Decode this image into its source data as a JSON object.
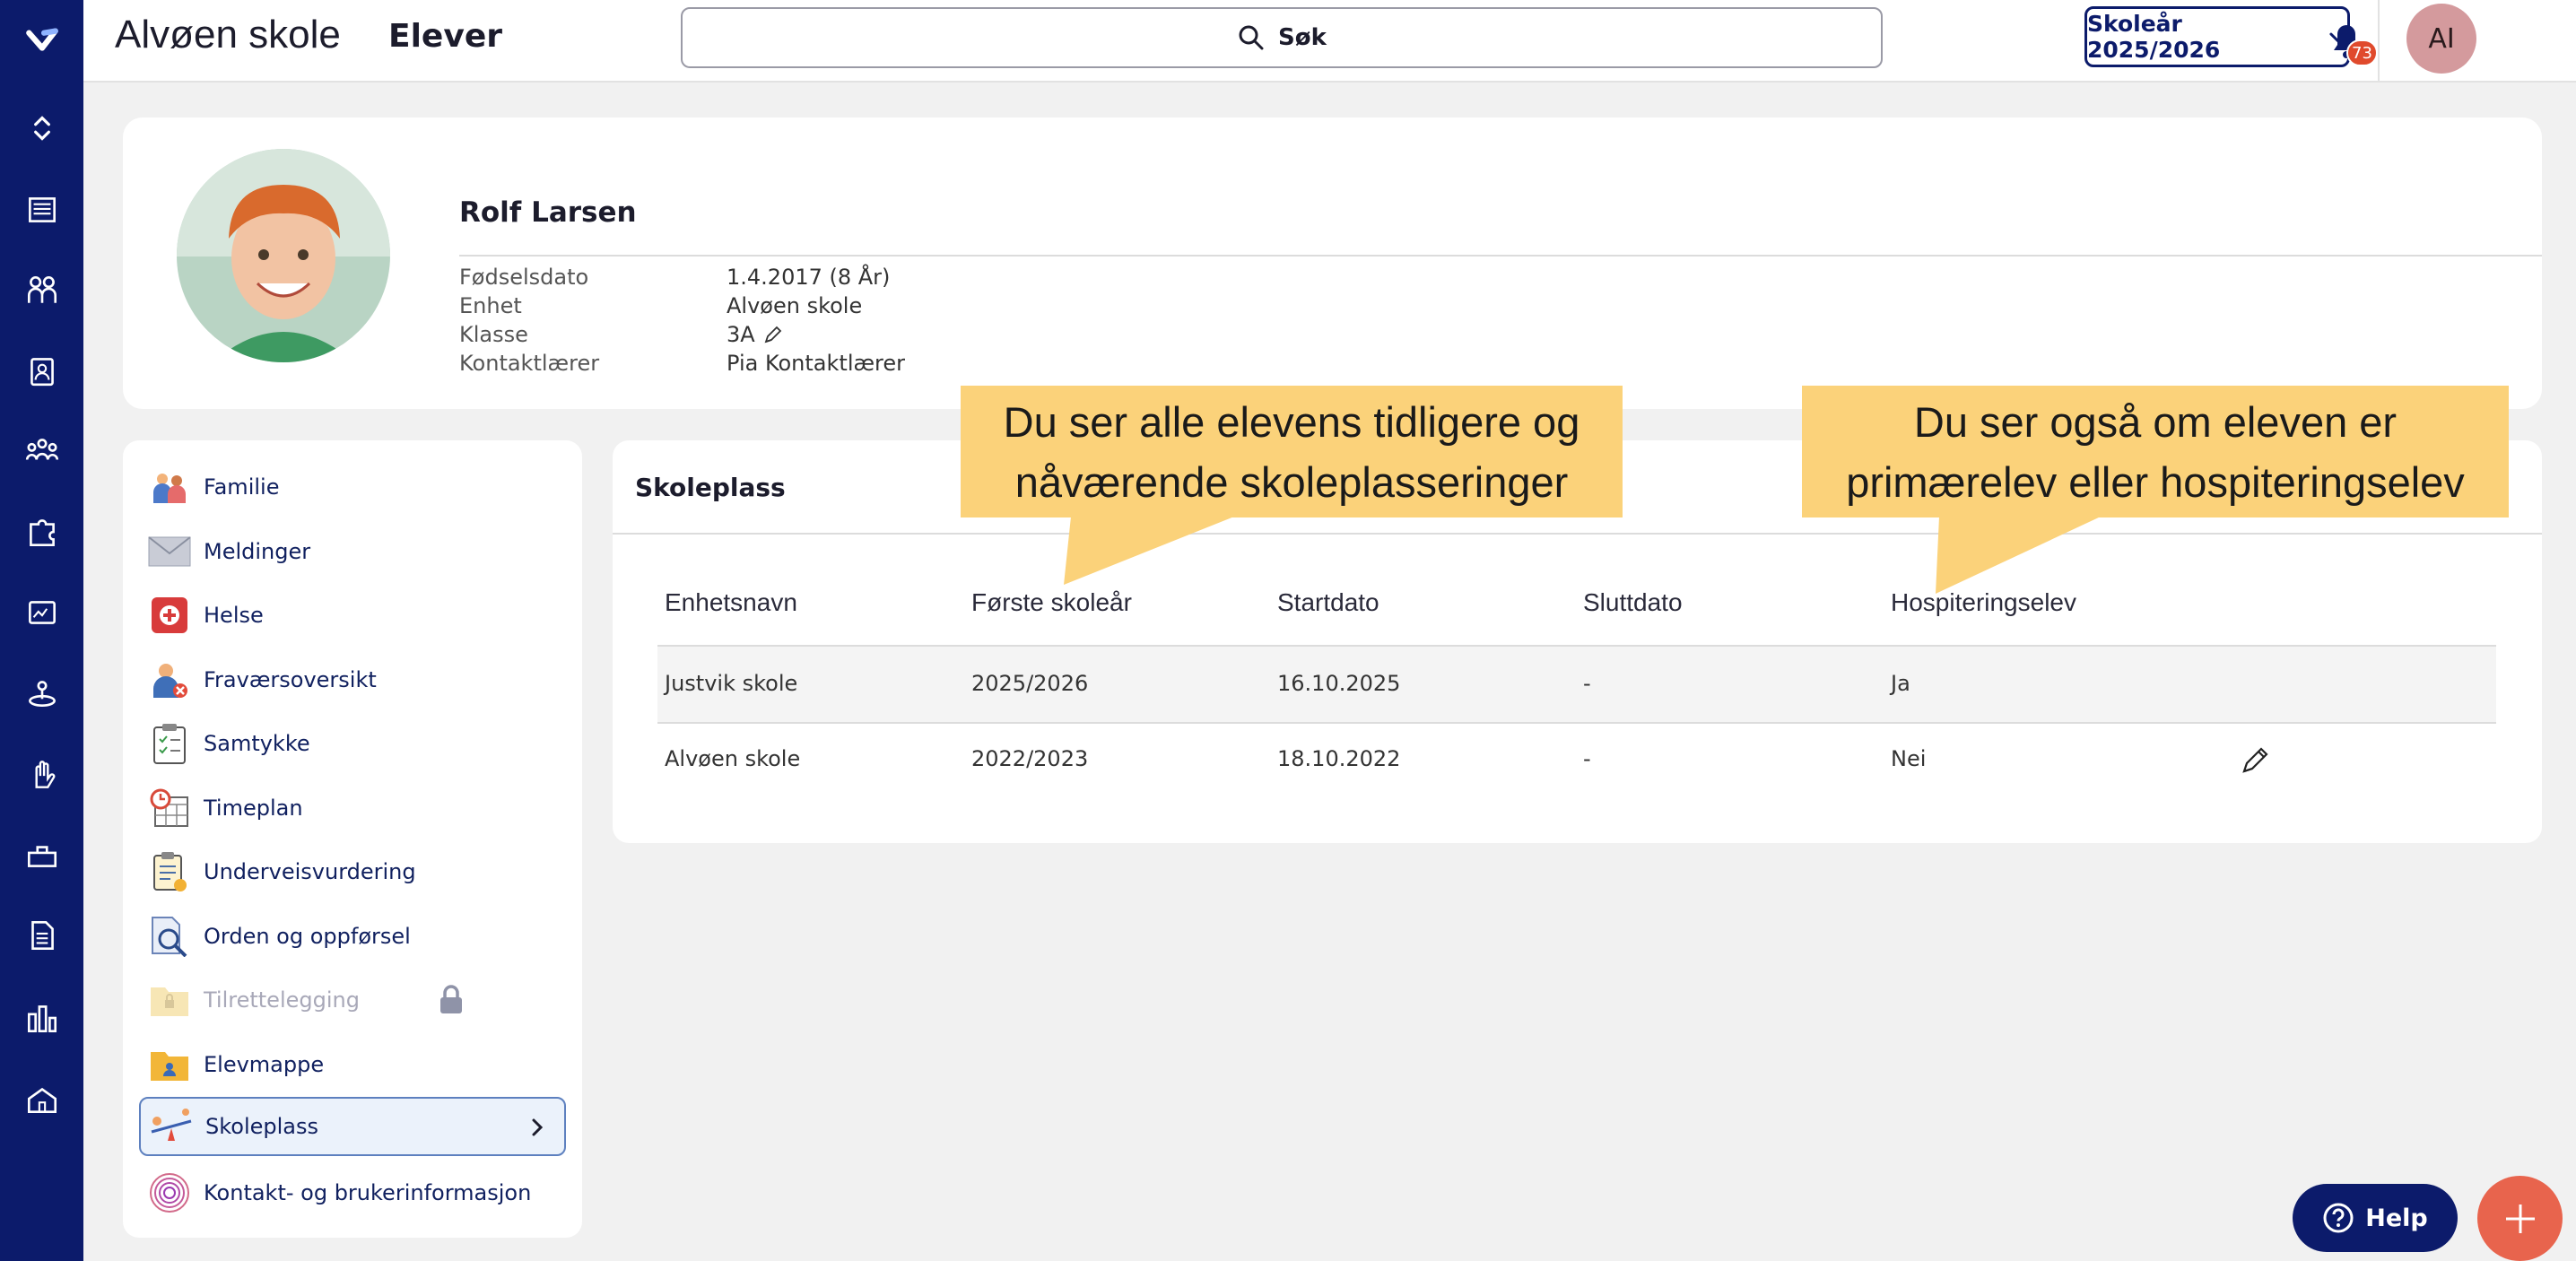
{
  "topbar": {
    "app_title": "Alvøen skole",
    "section_title": "Elever",
    "search_label": "Søk",
    "school_year_button": "Skoleår 2025/2026",
    "notification_count": "73",
    "user_initials": "AI"
  },
  "rail": {
    "icons": [
      "app-logo-icon",
      "expand-collapse-icon",
      "news-icon",
      "people-icon",
      "clipboard-user-icon",
      "group-icon",
      "puzzle-icon",
      "dashboard-icon",
      "person-orbit-icon",
      "raised-hand-icon",
      "desk-icon",
      "document-icon",
      "bar-chart-icon",
      "school-icon"
    ]
  },
  "student": {
    "name": "Rolf Larsen",
    "info": [
      {
        "label": "Fødselsdato",
        "value": "1.4.2017 (8 År)"
      },
      {
        "label": "Enhet",
        "value": "Alvøen skole"
      },
      {
        "label": "Klasse",
        "value": "3A"
      },
      {
        "label": "Kontaktlærer",
        "value": "Pia Kontaktlærer"
      }
    ]
  },
  "menu": {
    "items": [
      {
        "label": "Familie",
        "icon": "family-icon"
      },
      {
        "label": "Meldinger",
        "icon": "envelope-icon"
      },
      {
        "label": "Helse",
        "icon": "health-icon"
      },
      {
        "label": "Fraværsoversikt",
        "icon": "absence-icon"
      },
      {
        "label": "Samtykke",
        "icon": "consent-clipboard-icon"
      },
      {
        "label": "Timeplan",
        "icon": "schedule-icon"
      },
      {
        "label": "Underveisvurdering",
        "icon": "assessment-icon"
      },
      {
        "label": "Orden og oppførsel",
        "icon": "conduct-icon"
      },
      {
        "label": "Tilrettelegging",
        "icon": "locked-folder-icon",
        "disabled": true
      },
      {
        "label": "Elevmappe",
        "icon": "student-folder-icon"
      },
      {
        "label": "Skoleplass",
        "icon": "seesaw-icon",
        "active": true
      },
      {
        "label": "Kontakt- og brukerinformasjon",
        "icon": "fingerprint-icon"
      }
    ]
  },
  "panel": {
    "title": "Skoleplass",
    "columns": [
      "Enhetsnavn",
      "Første skoleår",
      "Startdato",
      "Sluttdato",
      "Hospiteringselev"
    ],
    "rows": [
      [
        "Justvik skole",
        "2025/2026",
        "16.10.2025",
        "-",
        "Ja"
      ],
      [
        "Alvøen skole",
        "2022/2023",
        "18.10.2022",
        "-",
        "Nei"
      ]
    ]
  },
  "callouts": {
    "left": {
      "line1": "Du ser alle elevens tidligere og",
      "line2": "nåværende skoleplasseringer"
    },
    "right": {
      "line1": "Du ser også om eleven er",
      "line2": "primærelev eller hospiteringselev"
    }
  },
  "help_button": "Help",
  "colors": {
    "navy": "#0c1b6b",
    "callout": "#fbd27a",
    "fab": "#e8644d",
    "badge": "#e04a2c"
  }
}
